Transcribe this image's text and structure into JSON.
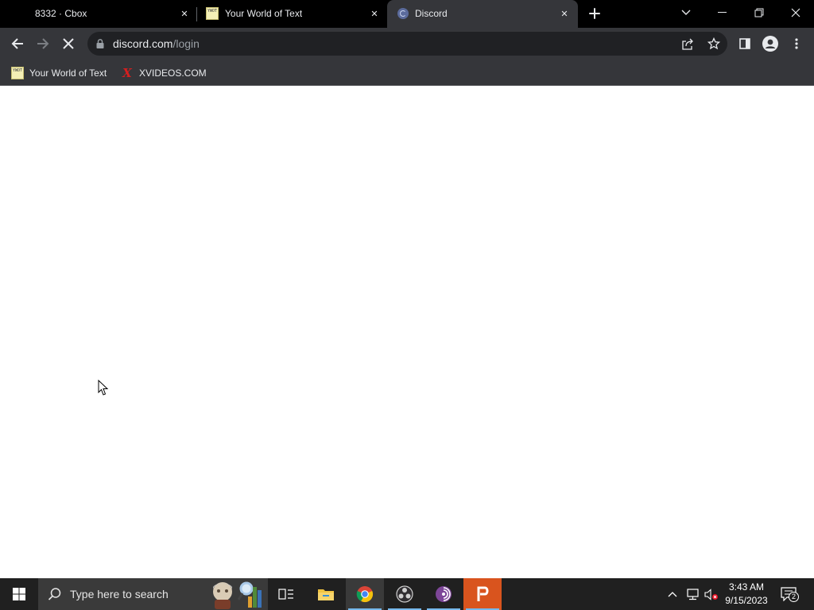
{
  "browser": {
    "tabs": [
      {
        "title": "8332 · Cbox",
        "active": false
      },
      {
        "title": "Your World of Text",
        "favicon_text": "YWOT",
        "active": false
      },
      {
        "title": "Discord",
        "active": true
      }
    ],
    "address": {
      "domain": "discord.com",
      "path": "/login"
    },
    "bookmarks": [
      {
        "label": "Your World of Text",
        "icon": "ywot-icon"
      },
      {
        "label": "XVIDEOS.COM",
        "icon_glyph": "X"
      }
    ],
    "loading": true
  },
  "taskbar": {
    "search_placeholder": "Type here to search",
    "clock_time": "3:43 AM",
    "clock_date": "9/15/2023",
    "notification_count": "2",
    "apps": [
      "task-view-icon",
      "file-explorer-icon",
      "chrome-icon",
      "obs-icon",
      "tor-browser-icon",
      "psiphon-icon"
    ]
  },
  "colors": {
    "tabstrip": "#000000",
    "toolbar": "#35363a",
    "omnibox": "#202124",
    "taskbar": "#202020",
    "accent": "#76b9ed"
  }
}
